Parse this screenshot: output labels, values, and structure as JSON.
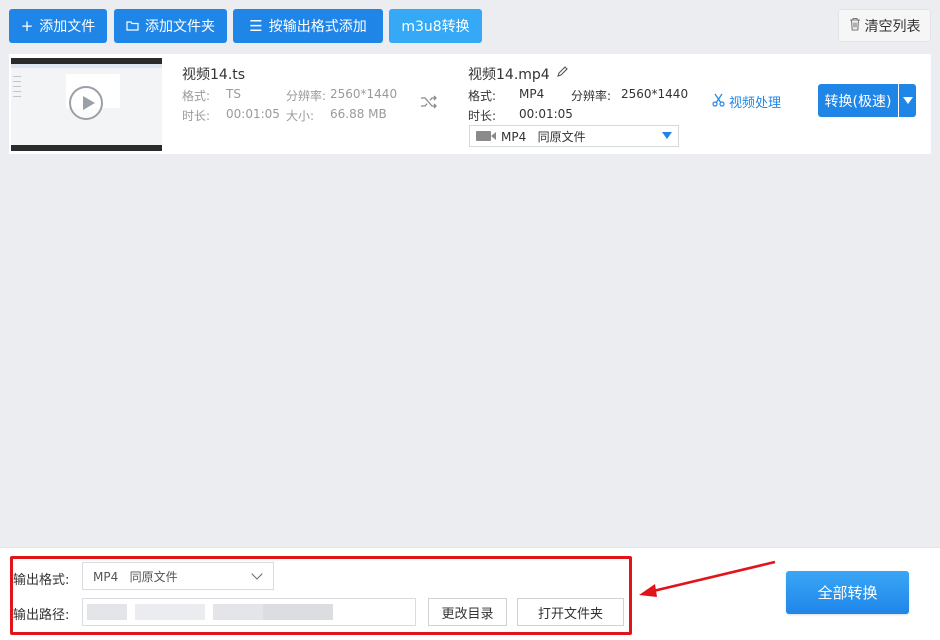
{
  "toolbar": {
    "add_file": "添加文件",
    "add_folder": "添加文件夹",
    "add_by_format": "按输出格式添加",
    "m3u8": "m3u8转换",
    "clear_list": "清空列表"
  },
  "file": {
    "source": {
      "name": "视频14.ts",
      "format_label": "格式:",
      "format": "TS",
      "resolution_label": "分辨率:",
      "resolution": "2560*1440",
      "duration_label": "时长:",
      "duration": "00:01:05",
      "size_label": "大小:",
      "size": "66.88 MB"
    },
    "target": {
      "name": "视频14.mp4",
      "format_label": "格式:",
      "format": "MP4",
      "resolution_label": "分辨率:",
      "resolution": "2560*1440",
      "duration_label": "时长:",
      "duration": "00:01:05",
      "format_select_value": "MP4   同原文件"
    },
    "video_process": "视频处理",
    "convert": "转换(极速)"
  },
  "bottom": {
    "output_format_label": "输出格式:",
    "output_format_value": "MP4   同原文件",
    "output_path_label": "输出路径:",
    "change_dir": "更改目录",
    "open_folder": "打开文件夹",
    "convert_all": "全部转换"
  },
  "colors": {
    "primary": "#1f86e8",
    "m3u8": "#35a9f5",
    "highlight": "#e1141a"
  }
}
